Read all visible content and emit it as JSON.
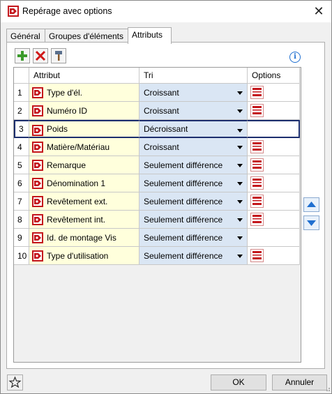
{
  "window": {
    "title": "Repérage avec options",
    "close_glyph": "✕"
  },
  "tabs": [
    {
      "label": "Général",
      "active": false
    },
    {
      "label": "Groupes d'éléments",
      "active": false
    },
    {
      "label": "Attributs",
      "active": true
    }
  ],
  "toolbar": {
    "add_icon": "add-green-plus-icon",
    "delete_icon": "delete-red-x-icon",
    "edit_icon": "edit-hammer-icon",
    "info_glyph": "i"
  },
  "table": {
    "columns": [
      "Attribut",
      "Tri",
      "Options"
    ],
    "rows": [
      {
        "num": "1",
        "attribute": "Type d'él.",
        "sort": "Croissant",
        "has_option": true,
        "selected": false
      },
      {
        "num": "2",
        "attribute": "Numéro ID",
        "sort": "Croissant",
        "has_option": true,
        "selected": false
      },
      {
        "num": "3",
        "attribute": "Poids",
        "sort": "Décroissant",
        "has_option": false,
        "selected": true
      },
      {
        "num": "4",
        "attribute": "Matière/Matériau",
        "sort": "Croissant",
        "has_option": true,
        "selected": false
      },
      {
        "num": "5",
        "attribute": "Remarque",
        "sort": "Seulement différence",
        "has_option": true,
        "selected": false
      },
      {
        "num": "6",
        "attribute": "Dénomination 1",
        "sort": "Seulement différence",
        "has_option": true,
        "selected": false
      },
      {
        "num": "7",
        "attribute": "Revêtement ext.",
        "sort": "Seulement différence",
        "has_option": true,
        "selected": false
      },
      {
        "num": "8",
        "attribute": "Revêtement int.",
        "sort": "Seulement différence",
        "has_option": true,
        "selected": false
      },
      {
        "num": "9",
        "attribute": "Id. de montage Vis",
        "sort": "Seulement différence",
        "has_option": false,
        "selected": false
      },
      {
        "num": "10",
        "attribute": "Type d'utilisation",
        "sort": "Seulement différence",
        "has_option": true,
        "selected": false
      }
    ]
  },
  "side_buttons": {
    "up_icon": "arrow-up-icon",
    "down_icon": "arrow-down-icon"
  },
  "footer": {
    "favorite_icon": "star-icon",
    "ok_label": "OK",
    "cancel_label": "Annuler"
  },
  "colors": {
    "attr_cell_bg": "#ffffdc",
    "sort_cell_bg": "#dae6f4",
    "selection_border": "#1c2e6e",
    "accent_blue": "#1f6fd0"
  }
}
